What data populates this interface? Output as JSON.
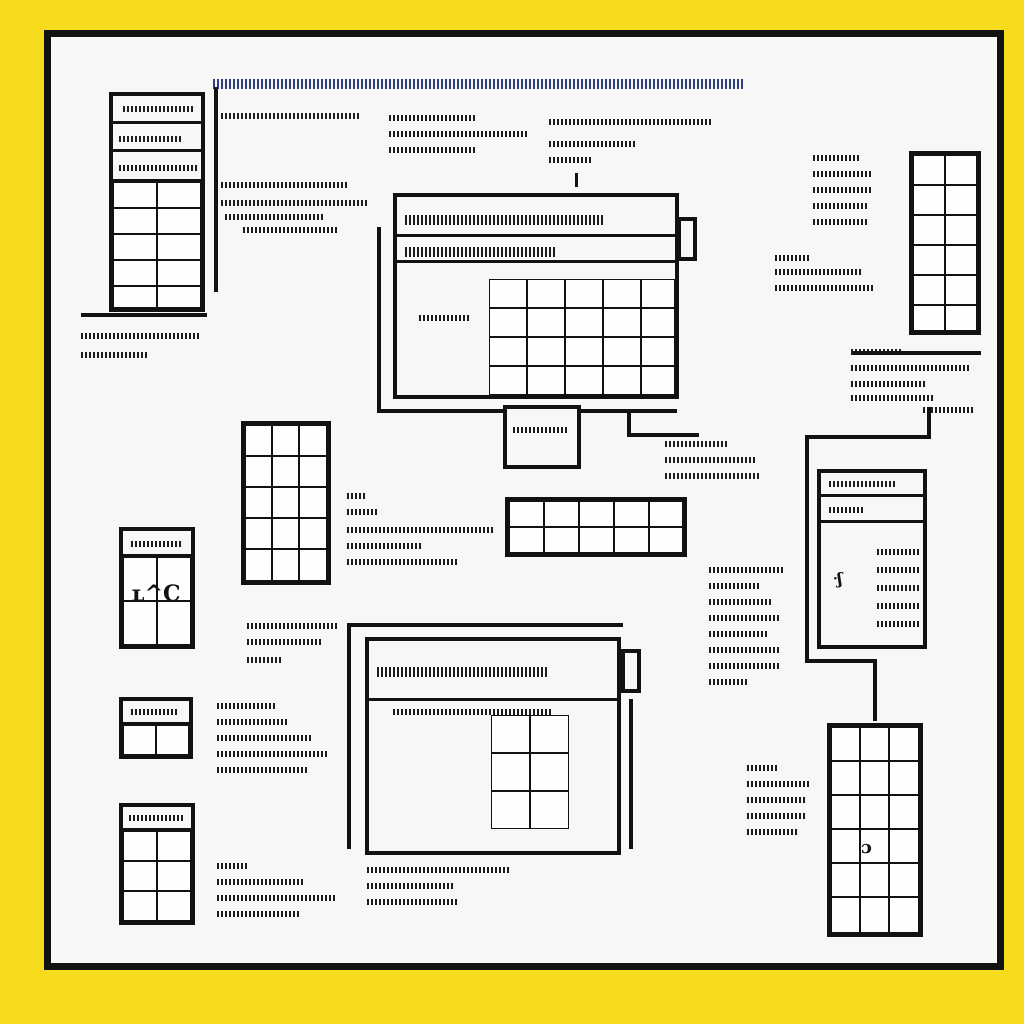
{
  "colors": {
    "background": "#F7DC1E",
    "paper": "#F7F8F6",
    "ink": "#121212",
    "blue_ink": "#24357A",
    "cell": "#FDFEFE"
  },
  "diagram": {
    "description_text": []
  }
}
